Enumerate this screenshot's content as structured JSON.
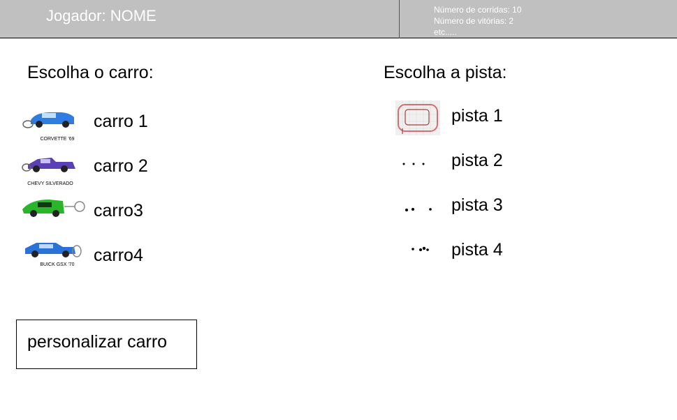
{
  "header": {
    "player": "Jogador: NOME",
    "stats": [
      "Número de corridas: 10",
      "Número de vitórias: 2",
      "etc....."
    ]
  },
  "cars": {
    "heading": "Escolha o carro:",
    "items": [
      {
        "label": "carro 1",
        "caption": "CORVETTE '69",
        "color": "#2f7de0"
      },
      {
        "label": "carro 2",
        "caption": "CHEVY SILVERADO",
        "color": "#5b3fb5"
      },
      {
        "label": "carro3",
        "caption": "",
        "color": "#2bb52b"
      },
      {
        "label": "carro4",
        "caption": "BUICK GSX '70",
        "color": "#2a72d8"
      }
    ]
  },
  "tracks": {
    "heading": "Escolha a pista:",
    "items": [
      {
        "label": "pista 1"
      },
      {
        "label": "pista 2"
      },
      {
        "label": "pista 3"
      },
      {
        "label": "pista 4"
      }
    ]
  },
  "actions": {
    "customize_label": "personalizar carro"
  }
}
